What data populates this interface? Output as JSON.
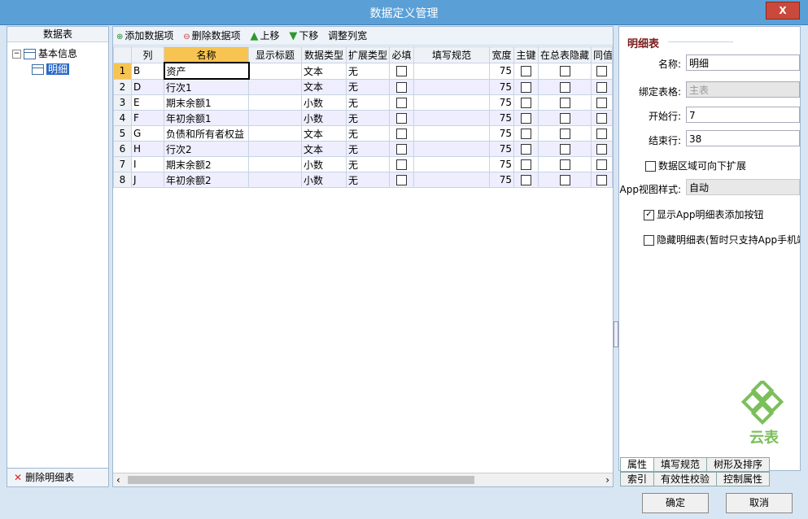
{
  "window": {
    "title": "数据定义管理",
    "close_label": "X"
  },
  "left_panel": {
    "header": "数据表",
    "tree_root": "基本信息",
    "tree_child": "明细",
    "delete_label": "删除明细表"
  },
  "toolbar": {
    "add": "添加数据项",
    "delete": "删除数据项",
    "up": "上移",
    "down": "下移",
    "adjust": "调整列宽"
  },
  "grid": {
    "columns": [
      "列",
      "名称",
      "显示标题",
      "数据类型",
      "扩展类型",
      "必填",
      "填写规范",
      "宽度",
      "主键",
      "在总表隐藏",
      "同值"
    ],
    "rows": [
      {
        "n": "1",
        "col": "B",
        "name": "资产",
        "title": "",
        "dtype": "文本",
        "etype": "无",
        "width": "75"
      },
      {
        "n": "2",
        "col": "D",
        "name": "行次1",
        "title": "",
        "dtype": "文本",
        "etype": "无",
        "width": "75"
      },
      {
        "n": "3",
        "col": "E",
        "name": "期末余额1",
        "title": "",
        "dtype": "小数",
        "etype": "无",
        "width": "75"
      },
      {
        "n": "4",
        "col": "F",
        "name": "年初余额1",
        "title": "",
        "dtype": "小数",
        "etype": "无",
        "width": "75"
      },
      {
        "n": "5",
        "col": "G",
        "name": "负债和所有者权益",
        "title": "",
        "dtype": "文本",
        "etype": "无",
        "width": "75"
      },
      {
        "n": "6",
        "col": "H",
        "name": "行次2",
        "title": "",
        "dtype": "文本",
        "etype": "无",
        "width": "75"
      },
      {
        "n": "7",
        "col": "I",
        "name": "期末余额2",
        "title": "",
        "dtype": "小数",
        "etype": "无",
        "width": "75"
      },
      {
        "n": "8",
        "col": "J",
        "name": "年初余额2",
        "title": "",
        "dtype": "小数",
        "etype": "无",
        "width": "75"
      }
    ]
  },
  "props": {
    "section_title": "明细表",
    "name_label": "名称:",
    "name_value": "明细",
    "bind_label": "绑定表格:",
    "bind_value": "主表",
    "start_label": "开始行:",
    "start_value": "7",
    "end_label": "结束行:",
    "end_value": "38",
    "expand_label": "数据区域可向下扩展",
    "expand_checked": false,
    "app_style_label": "App视图样式:",
    "app_style_value": "自动",
    "show_add_label": "显示App明细表添加按钮",
    "show_add_checked": true,
    "hide_label": "隐藏明细表(暂时只支持App手机端",
    "hide_checked": false,
    "logo_text": "云表"
  },
  "tabs": {
    "row1": [
      "属性",
      "填写规范",
      "树形及排序"
    ],
    "row2": [
      "索引",
      "有效性校验",
      "控制属性"
    ]
  },
  "buttons": {
    "ok": "确定",
    "cancel": "取消"
  },
  "colors": {
    "titlebar": "#5a9fd6",
    "close": "#c94a3c",
    "active_header": "#f7c451",
    "selected": "#2a6ac9"
  }
}
